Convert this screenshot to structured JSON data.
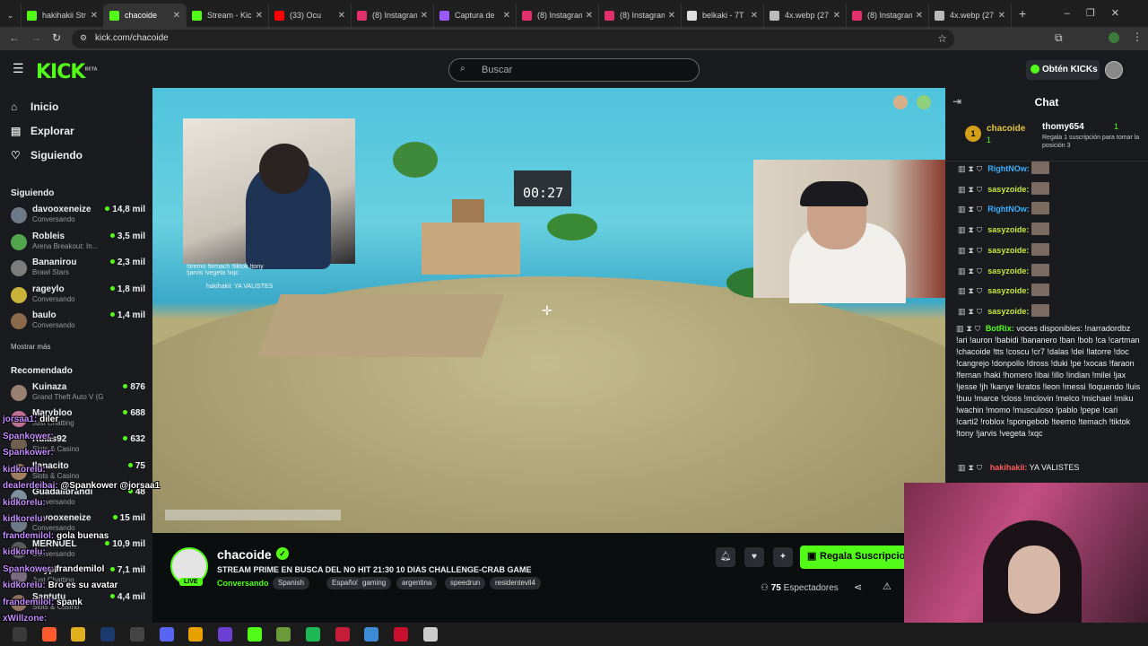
{
  "browser": {
    "tabs": [
      {
        "title": "hakihakii Str",
        "color": "#53fc18",
        "active": false
      },
      {
        "title": "chacoide",
        "color": "#53fc18",
        "active": true
      },
      {
        "title": "Stream - Kic",
        "color": "#53fc18",
        "active": false
      },
      {
        "title": "(33) Ocu",
        "color": "#ff0000",
        "active": false
      },
      {
        "title": "(8) Instagram",
        "color": "#e1306c",
        "active": false
      },
      {
        "title": "Captura de",
        "color": "#9b59ff",
        "active": false
      },
      {
        "title": "(8) Instagram",
        "color": "#e1306c",
        "active": false
      },
      {
        "title": "(8) Instagram",
        "color": "#e1306c",
        "active": false
      },
      {
        "title": "belkaki - 7T",
        "color": "#dddddd",
        "active": false
      },
      {
        "title": "4x.webp (27",
        "color": "#bbbbbb",
        "active": false
      },
      {
        "title": "(8) Instagram",
        "color": "#e1306c",
        "active": false
      },
      {
        "title": "4x.webp (27",
        "color": "#bbbbbb",
        "active": false
      }
    ],
    "url": "kick.com/chacoide"
  },
  "header": {
    "logo": "KICK",
    "logo_badge": "BETA",
    "search_placeholder": "Buscar",
    "get_kicks": "Obtén KICKs"
  },
  "sidebar": {
    "nav": [
      {
        "label": "Inicio",
        "icon": "home-icon",
        "glyph": "⌂"
      },
      {
        "label": "Explorar",
        "icon": "compass-icon",
        "glyph": "▤"
      },
      {
        "label": "Siguiendo",
        "icon": "heart-icon",
        "glyph": "♡"
      }
    ],
    "following_title": "Siguiendo",
    "following": [
      {
        "name": "davooxeneize",
        "sub": "Conversando",
        "viewers": "14,8 mil",
        "color": "#6f7a88"
      },
      {
        "name": "Robleis",
        "sub": "Arena Breakout: In...",
        "viewers": "3,5 mil",
        "color": "#53a54d"
      },
      {
        "name": "Bananirou",
        "sub": "Brawl Stars",
        "viewers": "2,3 mil",
        "color": "#7d7d7d"
      },
      {
        "name": "rageylo",
        "sub": "Conversando",
        "viewers": "1,8 mil",
        "color": "#c9b23a"
      },
      {
        "name": "baulo",
        "sub": "Conversando",
        "viewers": "1,4 mil",
        "color": "#8a6a4a"
      }
    ],
    "show_more": "Mostrar más",
    "recommended_title": "Recomendado",
    "recommended": [
      {
        "name": "Kuinaza",
        "sub": "Grand Theft Auto V (G...",
        "viewers": "876",
        "color": "#9a8070"
      },
      {
        "name": "Marybloo",
        "sub": "Just Chatting",
        "viewers": "688",
        "color": "#c07090"
      },
      {
        "name": "Rulas92",
        "sub": "Slots & Casino",
        "viewers": "632",
        "color": "#706050"
      },
      {
        "name": "Ilanacito",
        "sub": "Slots & Casino",
        "viewers": "75",
        "color": "#a08060"
      },
      {
        "name": "Guadalibrandi",
        "sub": "Conversando",
        "viewers": "48",
        "color": "#8090a0"
      },
      {
        "name": "davooxeneize",
        "sub": "Conversando",
        "viewers": "15 mil",
        "color": "#6f7a88"
      },
      {
        "name": "MERNUEL",
        "sub": "Conversando",
        "viewers": "10,9 mil",
        "color": "#5a5a5a"
      },
      {
        "name": "Soypl",
        "sub": "Just Chatting",
        "viewers": "7,1 mil",
        "color": "#7a6a80"
      },
      {
        "name": "Santutu",
        "sub": "Slots & Casino",
        "viewers": "4,4 mil",
        "color": "#907060"
      }
    ]
  },
  "video": {
    "timer": "00:27",
    "overlay_line1": "!teemo !temach !tiktok !tony",
    "overlay_line2": "!jarvis !vegeta !xqc",
    "overlay_line3": "hakihakii: YA VALISTES"
  },
  "stream": {
    "channel": "chacoide",
    "live": "LIVE",
    "title": "STREAM PRIME EN BUSCA DEL NO HIT 21:30 10 DIAS CHALLENGE-CRAB GAME",
    "category": "Conversando",
    "tags": [
      "Spanish",
      "Español",
      "gaming",
      "argentina",
      "speedrun",
      "residentevil4"
    ],
    "gift_button": "Regala Suscripcio",
    "viewers_count": "75",
    "viewers_label": "Espectadores"
  },
  "chat": {
    "title": "Chat",
    "pinned": {
      "rank": "1",
      "user1": "chacoide",
      "user1_count": "1",
      "user2": "thomy654",
      "user2_count": "1",
      "gift_note": "Regala 1 suscripción para tomar la posición 3"
    },
    "messages": [
      {
        "user": "RightNOw:",
        "color": "#3ab0ff"
      },
      {
        "user": "sasyzoide:",
        "color": "#c9e73a"
      },
      {
        "user": "RightNOw:",
        "color": "#3ab0ff"
      },
      {
        "user": "sasyzoide:",
        "color": "#c9e73a"
      },
      {
        "user": "sasyzoide:",
        "color": "#c9e73a"
      },
      {
        "user": "sasyzoide:",
        "color": "#c9e73a"
      },
      {
        "user": "sasyzoide:",
        "color": "#c9e73a"
      },
      {
        "user": "sasyzoide:",
        "color": "#c9e73a"
      }
    ],
    "bot_user": "BotRix:",
    "bot_text": "voces disponibles: !narradordbz !ari !auron !babidi !bananero !ban !bob !ca !cartman !chacoide !tts !coscu !cr7 !dalas !dei !latorre !doc !cangrejo !donpollo !dross !duki !pe !xocas !faraon !fernan !haki !homero !ibai !illo !indian !milei !jax !jesse !jh !kanye !kratos !leon !messi !loquendo !luis !buu !marce !closs !mclovin !melco !michael !miku !wachin !momo !musculoso !pablo !pepe !cari !carti2 !roblox !spongebob !teemo !temach !tiktok !tony !jarvis !vegeta !xqc",
    "last_user": "hakihakii:",
    "last_text": "YA VALISTES"
  },
  "overlay_chat": [
    {
      "user": "jorsaa1:",
      "text": "diler"
    },
    {
      "user": "Spankower:",
      "text": ""
    },
    {
      "user": "Spankower:",
      "text": ""
    },
    {
      "user": "kidkorelu:",
      "text": ""
    },
    {
      "user": "dealerdeibai:",
      "text": "@Spankower @jorsaa1"
    },
    {
      "user": "kidkorelu:",
      "text": ""
    },
    {
      "user": "kidkorelu:",
      "text": ""
    },
    {
      "user": "frandemilol:",
      "text": "gola buenas"
    },
    {
      "user": "kidkorelu:",
      "text": ""
    },
    {
      "user": "Spankower:",
      "text": "frandemilol"
    },
    {
      "user": "kidkorelu:",
      "text": "Bro es su avatar"
    },
    {
      "user": "frandemilol:",
      "text": "spank"
    },
    {
      "user": "xWillzone:",
      "text": ""
    },
    {
      "user": "kidkorelu",
      "text": ""
    }
  ]
}
